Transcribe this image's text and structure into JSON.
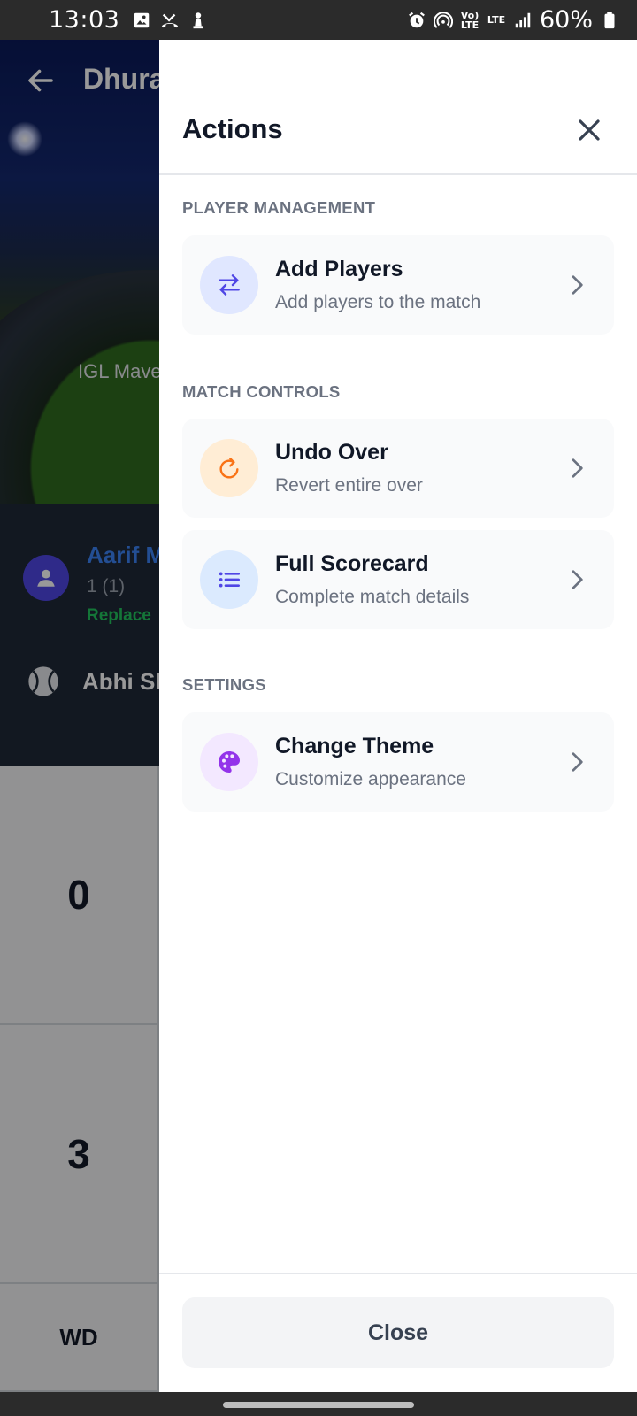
{
  "status_bar": {
    "time": "13:03",
    "battery_percent": "60%",
    "left_icons": [
      "image-icon",
      "missed-call-icon",
      "chess-pawn-icon"
    ],
    "right_icons": [
      "alarm-icon",
      "hotspot-icon",
      "volte-icon",
      "lte-icon",
      "signal-icon",
      "battery-icon"
    ],
    "volte_label": "Vo) LTE",
    "lte_label": "LTE"
  },
  "background_app": {
    "title": "Dhura",
    "team_label": "IGL Mave",
    "batter": {
      "name": "Aarif M",
      "score": "1 (1)",
      "replace_label": "Replace"
    },
    "bowler": {
      "name": "Abhi Sh"
    },
    "keypad": {
      "key_0": "0",
      "key_3": "3",
      "key_wd": "WD"
    }
  },
  "drawer": {
    "title": "Actions",
    "sections": [
      {
        "title": "PLAYER MANAGEMENT",
        "items": [
          {
            "label": "Add Players",
            "sub": "Add players to the match",
            "icon": "swap-arrows-icon",
            "icon_bg": "#e0e7ff",
            "icon_color": "#4f46e5"
          }
        ]
      },
      {
        "title": "MATCH CONTROLS",
        "items": [
          {
            "label": "Undo Over",
            "sub": "Revert entire over",
            "icon": "undo-icon",
            "icon_bg": "#ffedd5",
            "icon_color": "#f97316"
          },
          {
            "label": "Full Scorecard",
            "sub": "Complete match details",
            "icon": "list-icon",
            "icon_bg": "#dbeafe",
            "icon_color": "#4f46e5"
          }
        ]
      },
      {
        "title": "SETTINGS",
        "items": [
          {
            "label": "Change Theme",
            "sub": "Customize appearance",
            "icon": "palette-icon",
            "icon_bg": "#f3e8ff",
            "icon_color": "#9333ea"
          }
        ]
      }
    ],
    "close_label": "Close"
  },
  "colors": {
    "accent": "#4f46e5",
    "card_bg": "#f9fafb",
    "section_title": "#6b7280"
  }
}
